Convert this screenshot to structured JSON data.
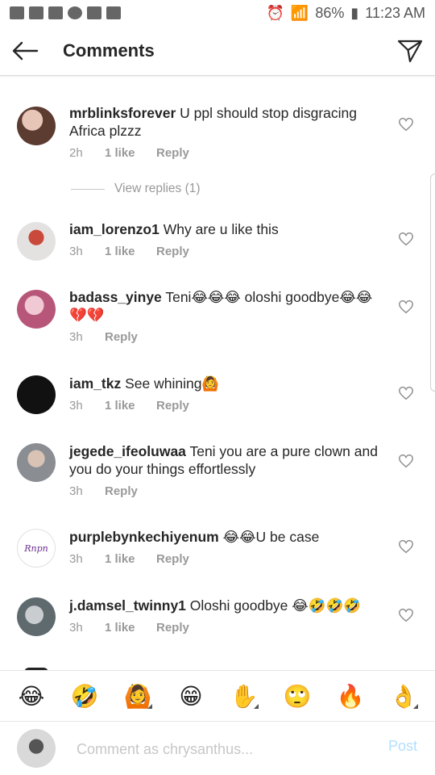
{
  "status_bar": {
    "battery": "86%",
    "time": "11:23 AM",
    "icons": [
      "sms-icon",
      "mail-icon",
      "gallery-icon",
      "whatsapp-icon",
      "image-icon",
      "email-icon",
      "alarm-icon",
      "wifi-icon",
      "signal-icon"
    ]
  },
  "header": {
    "title": "Comments",
    "back_icon": "arrow-left-icon",
    "send_icon": "send-icon"
  },
  "comments": [
    {
      "username": "mrblinksforever",
      "text": "U ppl should stop disgracing Africa plzzz",
      "time": "2h",
      "likes": "1 like",
      "reply": "Reply",
      "avatar_color": "#8a6a5c"
    },
    {
      "username": "iam_lorenzo1",
      "text": "Why are u like this",
      "time": "3h",
      "likes": "1 like",
      "reply": "Reply",
      "avatar_color": "#b94a3b"
    },
    {
      "username": "badass_yinye",
      "text": "Teni😂😂😂 oloshi goodbye😂😂💔💔",
      "time": "3h",
      "likes": "",
      "reply": "Reply",
      "avatar_color": "#c0728a"
    },
    {
      "username": "iam_tkz",
      "text": "See whining🙆",
      "time": "3h",
      "likes": "1 like",
      "reply": "Reply",
      "avatar_color": "#111111"
    },
    {
      "username": "jegede_ifeoluwaa",
      "text": "Teni you are a pure clown and you do your things effortlessly",
      "time": "3h",
      "likes": "",
      "reply": "Reply",
      "avatar_color": "#7b7f86"
    },
    {
      "username": "purplebynkechiyenum",
      "text": "😂😂U be case",
      "time": "3h",
      "likes": "1 like",
      "reply": "Reply",
      "avatar_color": "#ffffff",
      "avatar_text": "Rnpn"
    },
    {
      "username": "j.damsel_twinny1",
      "text": "Oloshi goodbye 😂🤣🤣🤣",
      "time": "3h",
      "likes": "1 like",
      "reply": "Reply",
      "avatar_color": "#6f7a7f"
    }
  ],
  "view_replies": "View replies (1)",
  "emoji_bar": [
    "😂",
    "🤣",
    "🙆",
    "😁",
    "✋",
    "🙄",
    "🔥",
    "👌"
  ],
  "composer": {
    "placeholder": "Comment as chrysanthus...",
    "post_label": "Post"
  },
  "colors": {
    "meta_gray": "#999999",
    "text": "#262626",
    "post_disabled": "#b2dffc"
  }
}
